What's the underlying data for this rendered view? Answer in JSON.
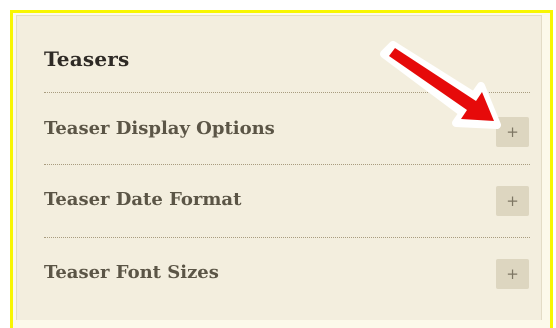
{
  "panel": {
    "title": "Teasers",
    "items": [
      {
        "label": "Teaser Display Options",
        "toggle": "+"
      },
      {
        "label": "Teaser Date Format",
        "toggle": "+"
      },
      {
        "label": "Teaser Font Sizes",
        "toggle": "+"
      }
    ]
  },
  "annotation": {
    "icon": "red-arrow-icon",
    "color": "#e60a0a"
  }
}
